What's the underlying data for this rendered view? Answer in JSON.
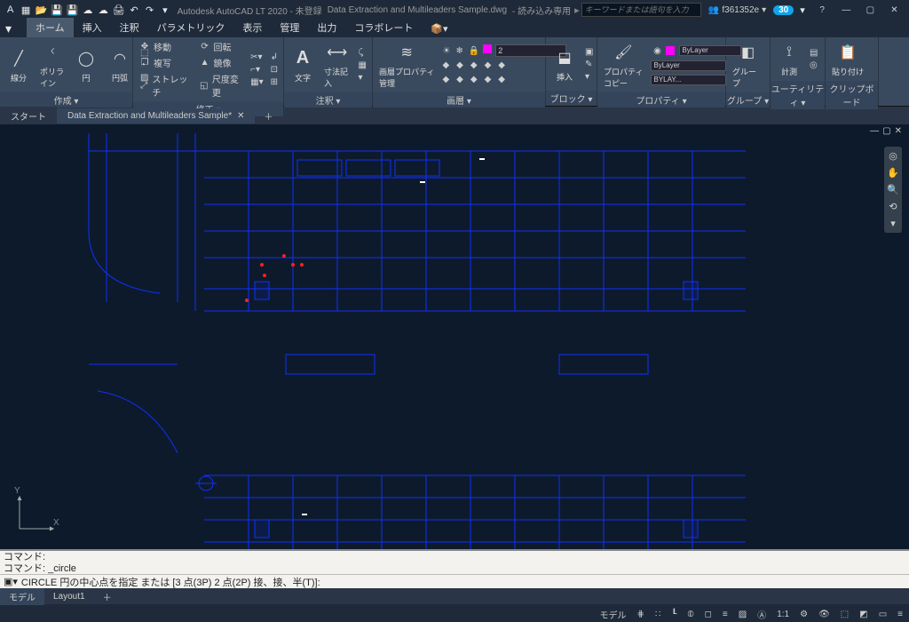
{
  "app": {
    "title_prefix": "Autodesk AutoCAD LT 2020 - 未登録",
    "document": "Data Extraction and Multileaders Sample.dwg",
    "readonly_suffix": "- 読み込み専用",
    "search_placeholder": "キーワードまたは語句を入力",
    "user": "f361352e",
    "trial_badge": "30"
  },
  "ribbon": {
    "tabs": [
      "ホーム",
      "挿入",
      "注釈",
      "パラメトリック",
      "表示",
      "管理",
      "出力",
      "コラボレート"
    ],
    "panels": {
      "draw": {
        "title": "作成 ▾",
        "line": "線分",
        "polyline": "ポリライン",
        "circle": "円",
        "arc": "円弧"
      },
      "modify": {
        "title": "修正 ▾",
        "move": "移動",
        "rotate": "回転",
        "mirror": "鏡像",
        "copy": "複写",
        "stretch": "ストレッチ",
        "scale": "尺度変更"
      },
      "annotate": {
        "title": "注釈 ▾",
        "text": "文字",
        "dim": "寸法記入"
      },
      "layers": {
        "title": "画層 ▾",
        "props": "画層プロパティ\n管理",
        "combo_value": "2"
      },
      "block": {
        "title": "ブロック ▾",
        "insert": "挿入"
      },
      "properties": {
        "title": "プロパティ ▾",
        "copy": "プロパティ\nコピー",
        "bylayer": "ByLayer",
        "bylayer2": "ByLayer",
        "bylay3": "BYLAY..."
      },
      "group": {
        "title": "グループ ▾",
        "label": "グループ"
      },
      "util": {
        "title": "ユーティリティ ▾",
        "measure": "計測"
      },
      "clipboard": {
        "title": "クリップボード",
        "paste": "貼り付け"
      }
    }
  },
  "filetabs": {
    "start": "スタート",
    "doc": "Data Extraction and Multileaders Sample*"
  },
  "command": {
    "hist1": "コマンド:",
    "hist2": "コマンド: _circle",
    "prompt": "CIRCLE 円の中心点を指定 または [3 点(3P) 2 点(2P) 接、接、半(T)]:"
  },
  "layout": {
    "model": "モデル",
    "layout1": "Layout1"
  },
  "status": {
    "model": "モデル",
    "scale": "1:1"
  },
  "axes": {
    "x": "X",
    "y": "Y"
  }
}
